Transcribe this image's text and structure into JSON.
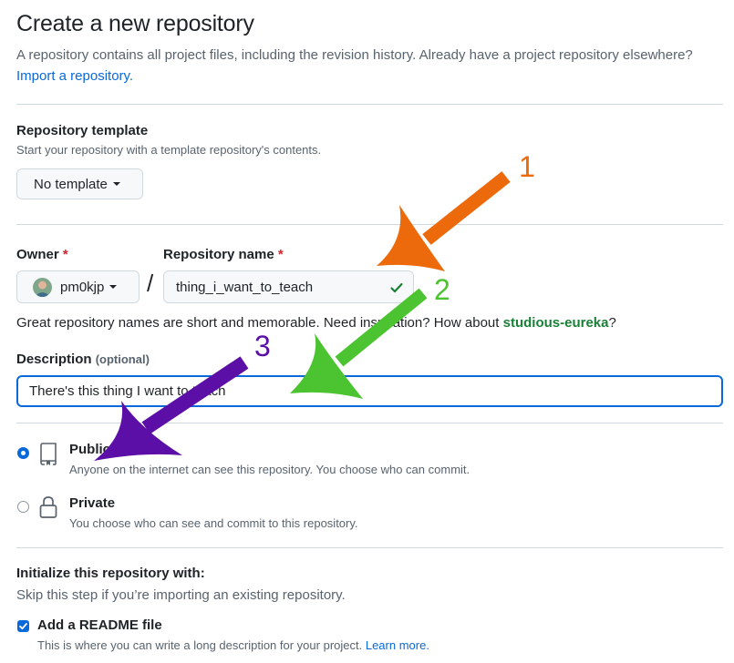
{
  "page": {
    "title": "Create a new repository",
    "intro_text": "A repository contains all project files, including the revision history. Already have a project repository elsewhere? ",
    "import_link": "Import a repository."
  },
  "template": {
    "label": "Repository template",
    "note": "Start your repository with a template repository's contents.",
    "button": "No template"
  },
  "owner": {
    "label": "Owner",
    "required": "*",
    "value": "pm0kjp"
  },
  "repo_name": {
    "label": "Repository name",
    "required": "*",
    "value": "thing_i_want_to_teach",
    "separator": "/"
  },
  "hint": {
    "prefix": "Great repository names are short and memorable. Need inspiration? How about ",
    "suggestion": "studious-eureka",
    "suffix": "?"
  },
  "description": {
    "label": "Description",
    "optional": "(optional)",
    "value": "There's this thing I want to teach"
  },
  "visibility": {
    "public_title": "Public",
    "public_desc": "Anyone on the internet can see this repository. You choose who can commit.",
    "private_title": "Private",
    "private_desc": "You choose who can see and commit to this repository.",
    "selected": "Public"
  },
  "init": {
    "label": "Initialize this repository with:",
    "note": "Skip this step if you’re importing an existing repository.",
    "readme_label": "Add a README file",
    "readme_checked": true,
    "readme_desc": "This is where you can write a long description for your project. ",
    "learn_more": "Learn more."
  },
  "annotations": {
    "arrow1_number": "1",
    "arrow1_color": "#ec6a0c",
    "arrow2_number": "2",
    "arrow2_color": "#4cc330",
    "arrow3_number": "3",
    "arrow3_color": "#5b0fa6"
  },
  "colors": {
    "accent": "#0969da",
    "success": "#1a7f37",
    "required": "#d1242f"
  }
}
